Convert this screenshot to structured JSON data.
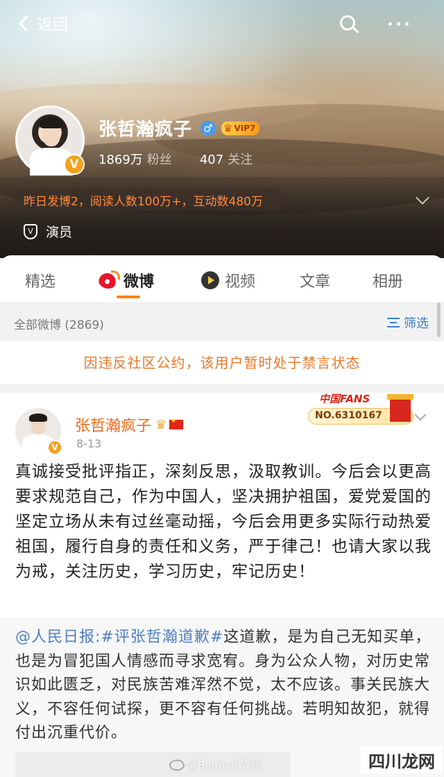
{
  "topbar": {
    "back_label": "返回"
  },
  "profile": {
    "name": "张哲瀚疯子",
    "vip_label": "VIP7",
    "followers_count": "1869万",
    "followers_label": "粉丝",
    "following_count": "407",
    "following_label": "关注",
    "summary": "昨日发博2，阅读人数100万+，互动数480万",
    "role": "演员"
  },
  "tabs": [
    {
      "label": "精选"
    },
    {
      "label": "微博"
    },
    {
      "label": "视频"
    },
    {
      "label": "文章"
    },
    {
      "label": "相册"
    }
  ],
  "filter": {
    "count_label": "全部微博 (2869)",
    "filter_label": "筛选"
  },
  "notice": "因违反社区公约，该用户暂时处于禁言状态",
  "post": {
    "author": "张哲瀚疯子",
    "date": "8-13",
    "fans_badge_title": "中国FANS",
    "fans_badge_no": "NO.6310167",
    "body": "真诚接受批评指正，深刻反思，汲取教训。今后会以更高要求规范自己，作为中国人，坚决拥护祖国，爱党爱国的坚定立场从未有过丝毫动摇，今后会用更多实际行动热爱祖国，履行自身的责任和义务，严于律己！也请大家以我为戒，关注历史，学习历史，牢记历史！",
    "repost_mention": "@人民日报",
    "repost_topic": ":#评张哲瀚道歉#",
    "repost_body": "这道歉，是为自己无知买单，也是为冒犯国人情感而寻求宽宥。身为公众人物，对历史常识如此匮乏，对民族苦难浑然不觉，太不应该。事关民族大义，不容任何试探，更不容有任何挑战。若明知故犯，就得付出沉重代价。"
  },
  "watermark": "@Bunny小课堂",
  "site_mark": "四川龙网",
  "colors": {
    "accent": "#ff8200",
    "name_orange": "#e86a1a",
    "link_blue": "#4f7fbf",
    "notice_orange": "#e7782b"
  }
}
